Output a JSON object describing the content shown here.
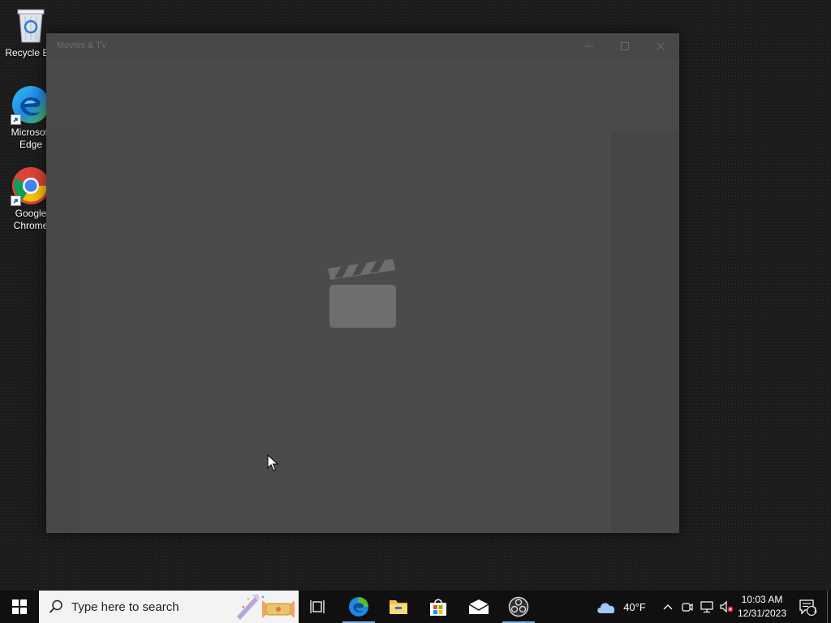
{
  "desktop": {
    "icons": [
      {
        "label": "Recycle Bin",
        "icon": "recycle-bin-icon"
      },
      {
        "label": "Microsoft Edge",
        "icon": "edge-icon"
      },
      {
        "label": "Google Chrome",
        "icon": "chrome-icon"
      }
    ]
  },
  "window": {
    "title": "Movies & TV",
    "controls": [
      "minimize",
      "maximize",
      "close"
    ],
    "splash_icon": "clapperboard-icon"
  },
  "taskbar": {
    "search_placeholder": "Type here to search",
    "pinned": [
      "task-view-icon",
      "edge-icon",
      "file-explorer-icon",
      "store-icon",
      "mail-icon",
      "obs-icon"
    ],
    "weather": "40°F",
    "time": "10:03 AM",
    "date": "12/31/2023",
    "notification_count": "1"
  },
  "colors": {
    "window_bg": "#484849",
    "taskbar_bg": "#101010",
    "accent": "#7aa9d8"
  }
}
